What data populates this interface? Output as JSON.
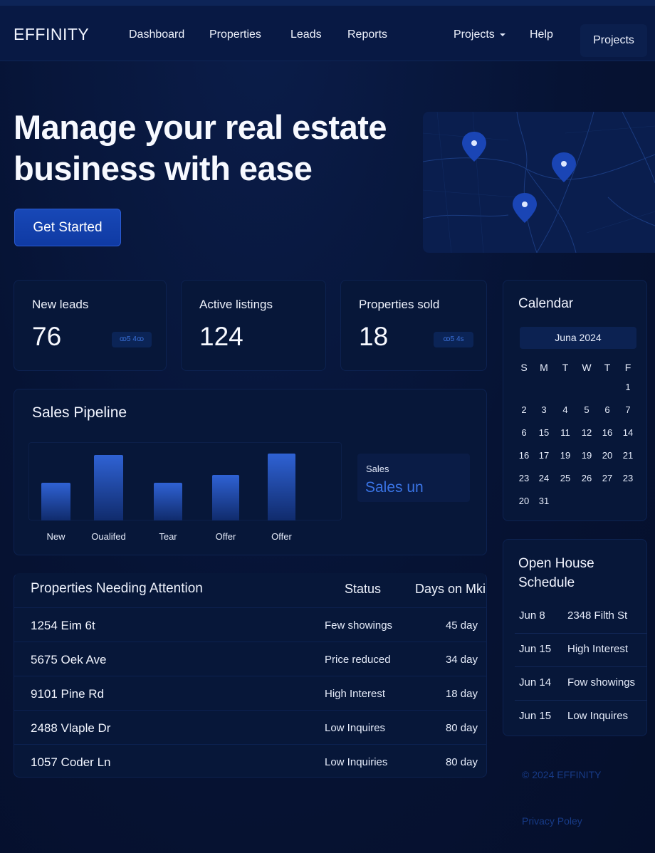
{
  "nav": {
    "brand": "EFFINITY",
    "links": [
      "Dashboard",
      "Properties",
      "Leads",
      "Reports"
    ],
    "projects_dropdown": "Projects",
    "help": "Help",
    "projects_button": "Projects"
  },
  "hero": {
    "title": "Manage your real estate business with ease",
    "cta": "Get Started"
  },
  "stats": [
    {
      "label": "New leads",
      "value": "76",
      "chip": "ꝏ5 4ꝏ"
    },
    {
      "label": "Active listings",
      "value": "124",
      "chip": ""
    },
    {
      "label": "Properties sold",
      "value": "18",
      "chip": "ꝏ5 4s"
    }
  ],
  "pipeline": {
    "title": "Sales Pipeline",
    "sales_label": "Sales",
    "sales_value": "Sales un",
    "chart_data": {
      "type": "bar",
      "categories": [
        "New",
        "Oualifed",
        "Tear",
        "Offer",
        "Offer"
      ],
      "values": [
        53,
        92,
        53,
        64,
        94
      ],
      "title": "",
      "xlabel": "",
      "ylabel": "",
      "ylim": [
        0,
        110
      ]
    }
  },
  "calendar": {
    "title": "Calendar",
    "month": "Juna 2024",
    "dow": [
      "S",
      "M",
      "T",
      "W",
      "T",
      "F"
    ],
    "rows": [
      [
        "",
        "",
        "",
        "",
        "",
        "1"
      ],
      [
        "2",
        "3",
        "4",
        "5",
        "6",
        "7"
      ],
      [
        "6",
        "15",
        "11",
        "12",
        "16",
        "14"
      ],
      [
        "16",
        "17",
        "19",
        "19",
        "20",
        "21"
      ],
      [
        "23",
        "24",
        "25",
        "26",
        "27",
        "23"
      ],
      [
        "20",
        "31",
        "",
        "",
        "",
        ""
      ]
    ]
  },
  "attention": {
    "title": "Properties Needing Attention",
    "col_status": "Status",
    "col_days": "Days on Mki",
    "rows": [
      {
        "address": "1254 Eim 6t",
        "status": "Few showings",
        "days": "45 day"
      },
      {
        "address": "5675 Oek Ave",
        "status": "Price reduced",
        "days": "34 day"
      },
      {
        "address": "9101 Pine Rd",
        "status": "High Interest",
        "days": "18 day"
      },
      {
        "address": "2488 Vlaple Dr",
        "status": "Low Inquires",
        "days": "80 day"
      },
      {
        "address": "1057 Coder Ln",
        "status": "Low Inquiries",
        "days": "80 day"
      }
    ]
  },
  "open_house": {
    "title": "Open House Schedule",
    "rows": [
      {
        "date": "Jun 8",
        "text": "2348 Filth St"
      },
      {
        "date": "Jun 15",
        "text": "High Interest"
      },
      {
        "date": "Jun 14",
        "text": "Fow showings"
      },
      {
        "date": "Jun 15",
        "text": "Low Inquires"
      }
    ]
  },
  "footer": {
    "copyright": "© 2024 EFFINITY",
    "privacy": "Privacy Poley"
  }
}
